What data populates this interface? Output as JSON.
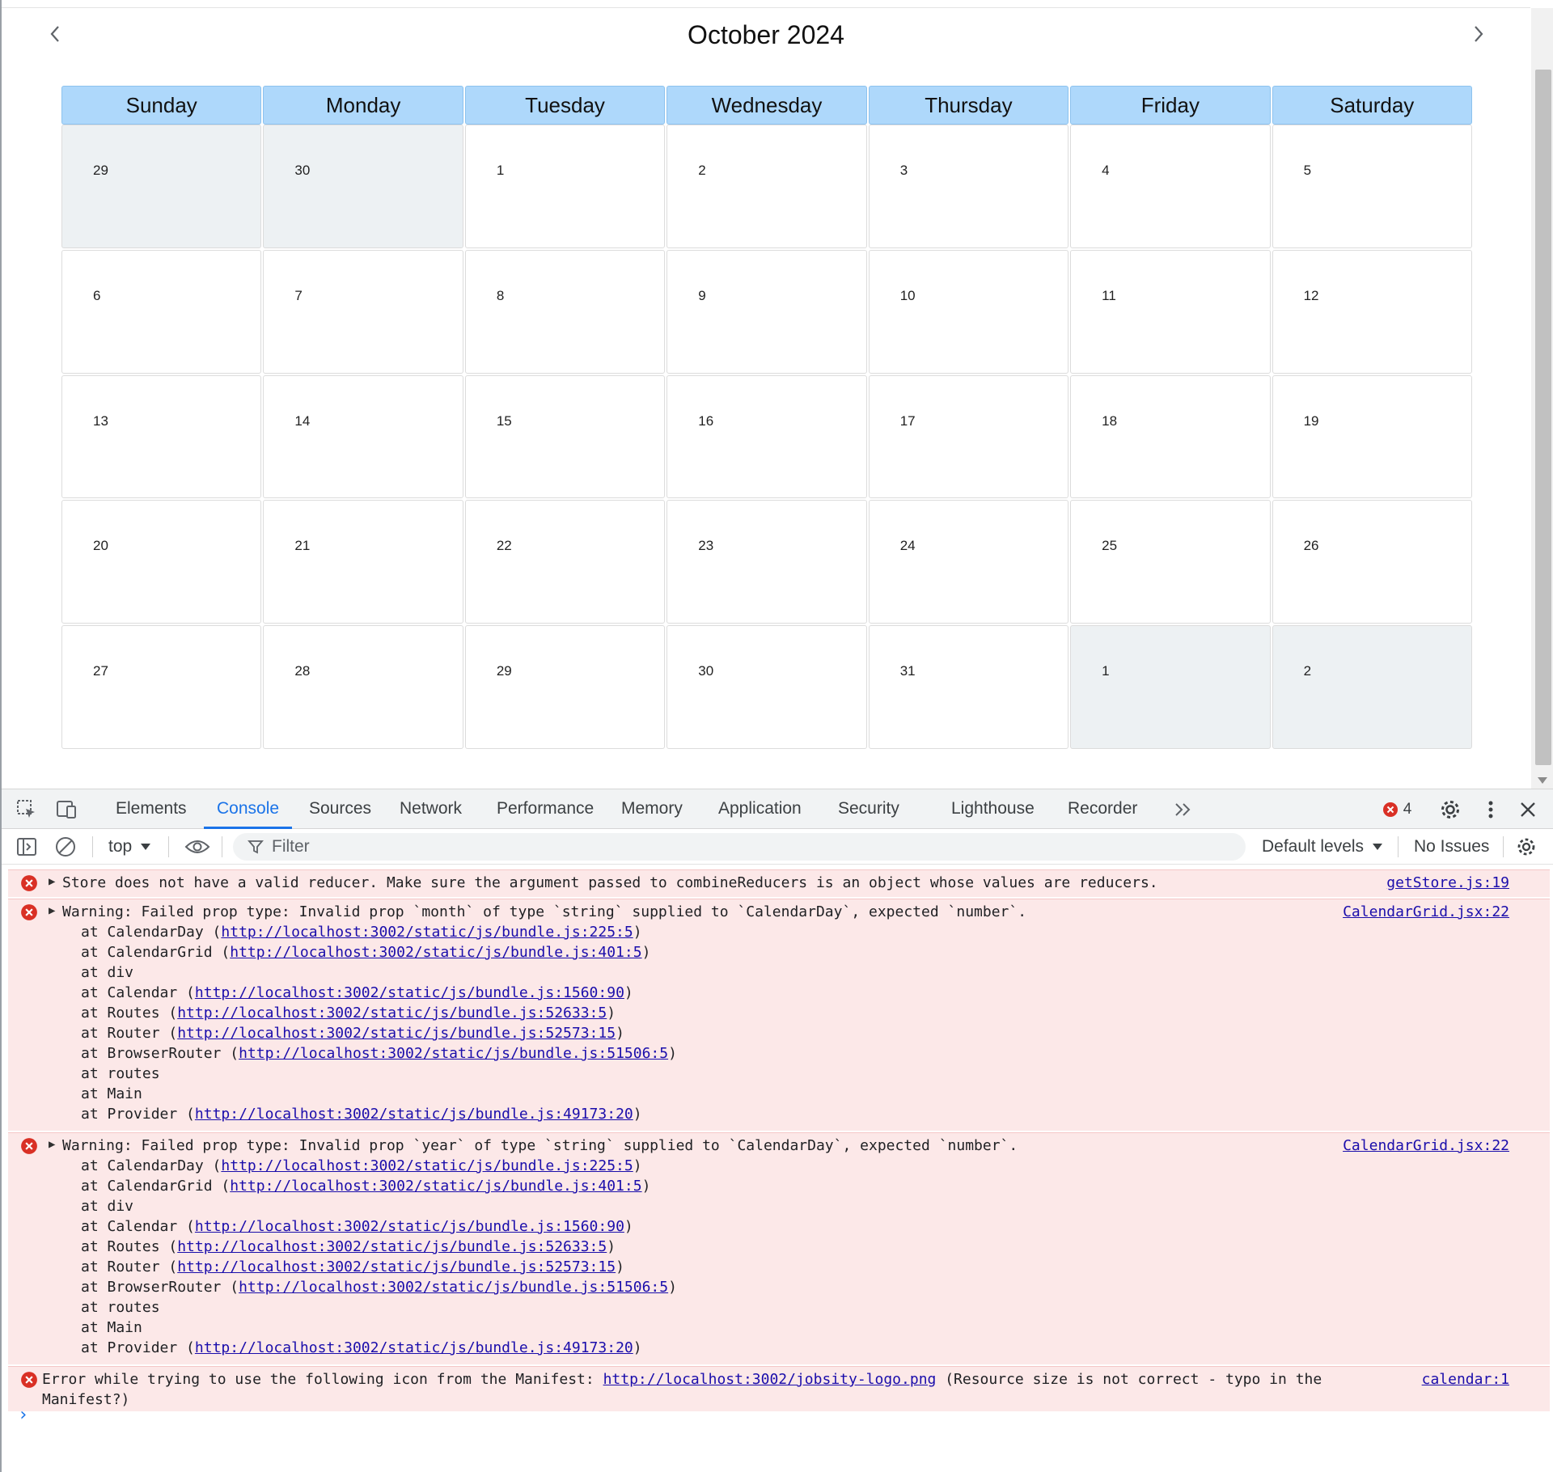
{
  "calendar": {
    "title": "October 2024",
    "weekdays": [
      "Sunday",
      "Monday",
      "Tuesday",
      "Wednesday",
      "Thursday",
      "Friday",
      "Saturday"
    ],
    "weeks": [
      [
        {
          "day": "29",
          "other": true
        },
        {
          "day": "30",
          "other": true
        },
        {
          "day": "1",
          "other": false
        },
        {
          "day": "2",
          "other": false
        },
        {
          "day": "3",
          "other": false
        },
        {
          "day": "4",
          "other": false
        },
        {
          "day": "5",
          "other": false
        }
      ],
      [
        {
          "day": "6",
          "other": false
        },
        {
          "day": "7",
          "other": false
        },
        {
          "day": "8",
          "other": false
        },
        {
          "day": "9",
          "other": false
        },
        {
          "day": "10",
          "other": false
        },
        {
          "day": "11",
          "other": false
        },
        {
          "day": "12",
          "other": false
        }
      ],
      [
        {
          "day": "13",
          "other": false
        },
        {
          "day": "14",
          "other": false
        },
        {
          "day": "15",
          "other": false
        },
        {
          "day": "16",
          "other": false
        },
        {
          "day": "17",
          "other": false
        },
        {
          "day": "18",
          "other": false
        },
        {
          "day": "19",
          "other": false
        }
      ],
      [
        {
          "day": "20",
          "other": false
        },
        {
          "day": "21",
          "other": false
        },
        {
          "day": "22",
          "other": false
        },
        {
          "day": "23",
          "other": false
        },
        {
          "day": "24",
          "other": false
        },
        {
          "day": "25",
          "other": false
        },
        {
          "day": "26",
          "other": false
        }
      ],
      [
        {
          "day": "27",
          "other": false
        },
        {
          "day": "28",
          "other": false
        },
        {
          "day": "29",
          "other": false
        },
        {
          "day": "30",
          "other": false
        },
        {
          "day": "31",
          "other": false
        },
        {
          "day": "1",
          "other": true
        },
        {
          "day": "2",
          "other": true
        }
      ]
    ],
    "colors": {
      "header": "#aed8fb",
      "other_month": "#edf1f3"
    }
  },
  "devtools": {
    "tabs": [
      "Elements",
      "Console",
      "Sources",
      "Network",
      "Performance",
      "Memory",
      "Application",
      "Security",
      "Lighthouse",
      "Recorder"
    ],
    "active_tab": "Console",
    "error_count": "4",
    "toolbar": {
      "context": "top",
      "filter_placeholder": "Filter",
      "levels": "Default levels",
      "issues": "No Issues"
    },
    "messages": [
      {
        "text": "Store does not have a valid reducer. Make sure the argument passed to combineReducers is an object whose values are reducers.",
        "source": "getStore.js:19",
        "stack": []
      },
      {
        "text": "Warning: Failed prop type: Invalid prop `month` of type `string` supplied to `CalendarDay`, expected `number`.",
        "source": "CalendarGrid.jsx:22",
        "stack": [
          {
            "name": "at CalendarDay (",
            "url": "http://localhost:3002/static/js/bundle.js:225:5",
            "end": ")"
          },
          {
            "name": "at CalendarGrid (",
            "url": "http://localhost:3002/static/js/bundle.js:401:5",
            "end": ")"
          },
          {
            "name": "at div",
            "url": "",
            "end": ""
          },
          {
            "name": "at Calendar (",
            "url": "http://localhost:3002/static/js/bundle.js:1560:90",
            "end": ")"
          },
          {
            "name": "at Routes (",
            "url": "http://localhost:3002/static/js/bundle.js:52633:5",
            "end": ")"
          },
          {
            "name": "at Router (",
            "url": "http://localhost:3002/static/js/bundle.js:52573:15",
            "end": ")"
          },
          {
            "name": "at BrowserRouter (",
            "url": "http://localhost:3002/static/js/bundle.js:51506:5",
            "end": ")"
          },
          {
            "name": "at routes",
            "url": "",
            "end": ""
          },
          {
            "name": "at Main",
            "url": "",
            "end": ""
          },
          {
            "name": "at Provider (",
            "url": "http://localhost:3002/static/js/bundle.js:49173:20",
            "end": ")"
          }
        ]
      },
      {
        "text": "Warning: Failed prop type: Invalid prop `year` of type `string` supplied to `CalendarDay`, expected `number`.",
        "source": "CalendarGrid.jsx:22",
        "stack": [
          {
            "name": "at CalendarDay (",
            "url": "http://localhost:3002/static/js/bundle.js:225:5",
            "end": ")"
          },
          {
            "name": "at CalendarGrid (",
            "url": "http://localhost:3002/static/js/bundle.js:401:5",
            "end": ")"
          },
          {
            "name": "at div",
            "url": "",
            "end": ""
          },
          {
            "name": "at Calendar (",
            "url": "http://localhost:3002/static/js/bundle.js:1560:90",
            "end": ")"
          },
          {
            "name": "at Routes (",
            "url": "http://localhost:3002/static/js/bundle.js:52633:5",
            "end": ")"
          },
          {
            "name": "at Router (",
            "url": "http://localhost:3002/static/js/bundle.js:52573:15",
            "end": ")"
          },
          {
            "name": "at BrowserRouter (",
            "url": "http://localhost:3002/static/js/bundle.js:51506:5",
            "end": ")"
          },
          {
            "name": "at routes",
            "url": "",
            "end": ""
          },
          {
            "name": "at Main",
            "url": "",
            "end": ""
          },
          {
            "name": "at Provider (",
            "url": "http://localhost:3002/static/js/bundle.js:49173:20",
            "end": ")"
          }
        ]
      },
      {
        "prefix": "Error while trying to use the following icon from the Manifest: ",
        "url": "http://localhost:3002/jobsity-logo.png",
        "suffix": " (Resource size is not correct - typo in the",
        "line2": "Manifest?)",
        "source": "calendar:1"
      }
    ],
    "colors": {
      "accent": "#1a73e8",
      "error_bg": "#fce8e8",
      "error_icon": "#d93025"
    }
  }
}
